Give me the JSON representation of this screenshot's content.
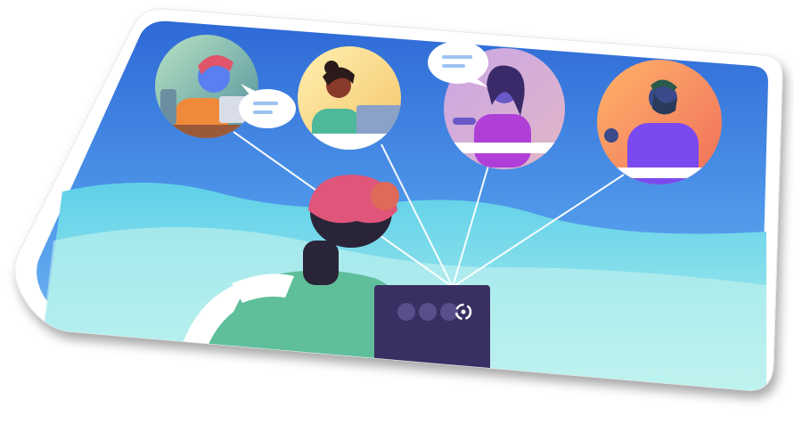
{
  "scene": {
    "description_icon": "video-call-illustration",
    "participants": [
      {
        "role": "support-agent",
        "speech_bubble": true
      },
      {
        "role": "laptop-user",
        "speech_bubble": false
      },
      {
        "role": "presenter",
        "speech_bubble": true
      },
      {
        "role": "bearded-speaker",
        "speech_bubble": false
      }
    ],
    "logo_icon": "app-logo-icon"
  },
  "colors": {
    "sky_top": "#2f6fd8",
    "sky_bottom": "#6fb6f0",
    "wave_light": "#8fe4f0",
    "wave_mid": "#5ccfe6",
    "hair": "#e0557a",
    "shirt": "#5fbf9a",
    "laptop": "#3a2f63"
  }
}
